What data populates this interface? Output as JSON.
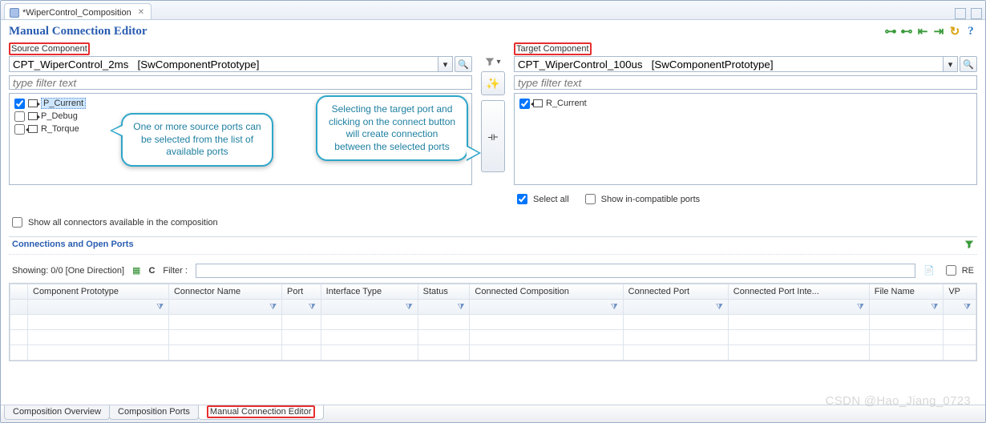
{
  "tab": {
    "title": "*WiperControl_Composition"
  },
  "header": {
    "title": "Manual Connection Editor"
  },
  "source": {
    "label": "Source Component",
    "selected": "CPT_WiperControl_2ms   [SwComponentPrototype]",
    "filter_placeholder": "type filter text",
    "ports": [
      {
        "name": "P_Current",
        "checked": true,
        "dir": "out",
        "highlight": true
      },
      {
        "name": "P_Debug",
        "checked": false,
        "dir": "out",
        "highlight": false
      },
      {
        "name": "R_Torque",
        "checked": false,
        "dir": "in",
        "highlight": false
      }
    ]
  },
  "target": {
    "label": "Target Component",
    "selected": "CPT_WiperControl_100us   [SwComponentPrototype]",
    "filter_placeholder": "type filter text",
    "ports": [
      {
        "name": "R_Current",
        "checked": true,
        "dir": "in"
      }
    ],
    "select_all_label": "Select all",
    "show_incompat_label": "Show in-compatible ports",
    "select_all_checked": true,
    "show_incompat_checked": false
  },
  "callouts": {
    "c1": "One or more source ports can be selected from the list of available ports",
    "c2": "Selecting the target port and clicking on the connect button will create connection between the selected ports"
  },
  "show_all_conn_label": "Show all connectors available in the composition",
  "group_title": "Connections and Open Ports",
  "listbar": {
    "showing": "Showing: 0/0 [One Direction]",
    "filter_label": "Filter :",
    "re_label": "RE"
  },
  "columns": [
    "Component Prototype",
    "Connector Name",
    "Port",
    "Interface Type",
    "Status",
    "Connected Composition",
    "Connected Port",
    "Connected Port Inte...",
    "File Name",
    "VP"
  ],
  "bottom_tabs": [
    "Composition Overview",
    "Composition Ports",
    "Manual Connection Editor"
  ],
  "watermark": "CSDN @Hao_Jiang_0723"
}
